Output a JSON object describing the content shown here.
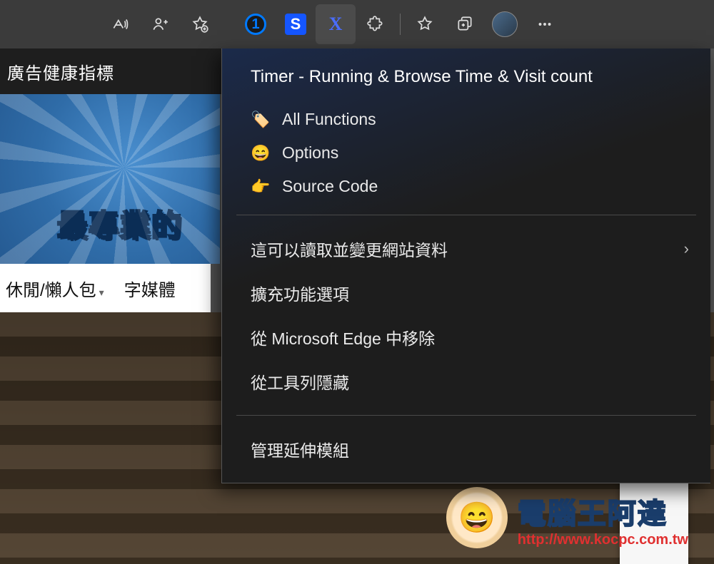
{
  "toolbar": {
    "icons": {
      "read_aloud": "read-aloud-icon",
      "person": "profile-add-icon",
      "favorite_add": "star-add-icon",
      "ext_1password": "1",
      "ext_s": "S",
      "ext_timer": "X",
      "extensions": "puzzle-icon",
      "favorites": "star-icon",
      "collections": "collections-icon",
      "avatar": "avatar",
      "more": "more-icon"
    }
  },
  "sitebar": {
    "text": "廣告健康指標"
  },
  "hero": {
    "tagline": "最專業的"
  },
  "nav": {
    "item1": "休閒/懶人包",
    "item2": "字媒體"
  },
  "menu": {
    "title": "Timer - Running & Browse Time & Visit count",
    "links": [
      {
        "icon": "🏷️",
        "label": "All Functions"
      },
      {
        "icon": "😄",
        "label": "Options"
      },
      {
        "icon": "👉",
        "label": "Source Code"
      }
    ],
    "actions": {
      "read_change": "這可以讀取並變更網站資料",
      "ext_options": "擴充功能選項",
      "remove": "從 Microsoft Edge 中移除",
      "hide": "從工具列隱藏",
      "manage": "管理延伸模組"
    }
  },
  "watermark": {
    "title": "電腦王阿達",
    "url": "http://www.kocpc.com.tw"
  }
}
